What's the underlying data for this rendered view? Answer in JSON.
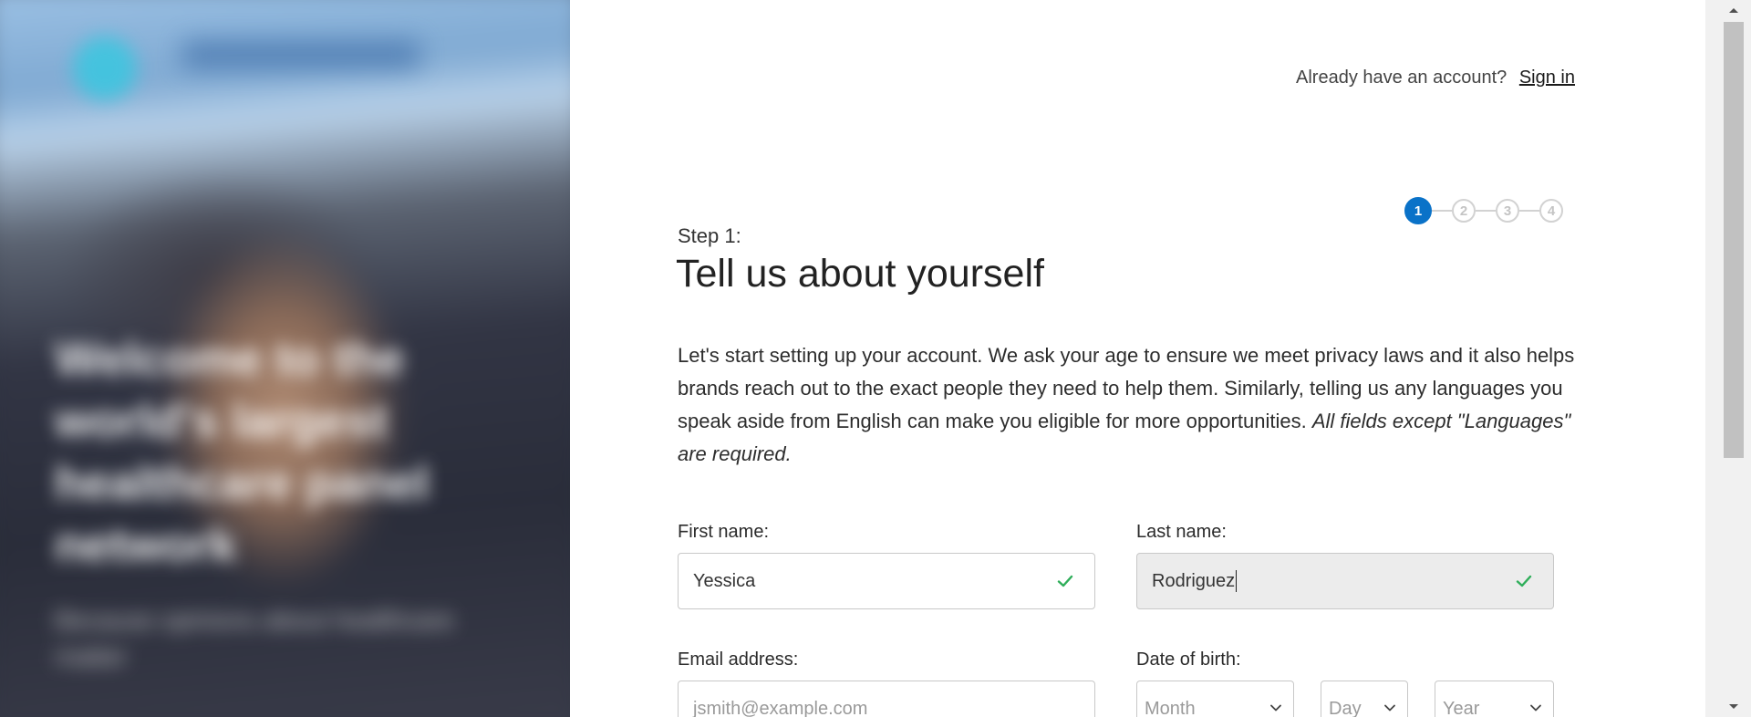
{
  "hero": {
    "headline": "Welcome to the world's largest healthcare panel network",
    "subtext": "Because opinions about healthcare matter"
  },
  "header": {
    "account_prompt": "Already have an account?",
    "signin_label": "Sign in"
  },
  "stepper": {
    "steps": [
      "1",
      "2",
      "3",
      "4"
    ],
    "current": 1
  },
  "main": {
    "step_label": "Step 1:",
    "title": "Tell us about yourself",
    "intro": "Let's start setting up your account. We ask your age to ensure we meet privacy laws and it also helps brands reach out to the exact people they need to help them. Similarly, telling us any languages you speak aside from English can make you eligible for more opportunities.",
    "intro_note": "All fields except \"Languages\" are required."
  },
  "form": {
    "first_name": {
      "label": "First name:",
      "value": "Yessica"
    },
    "last_name": {
      "label": "Last name:",
      "value": "Rodriguez"
    },
    "email": {
      "label": "Email address:",
      "placeholder": "jsmith@example.com"
    },
    "dob": {
      "label": "Date of birth:",
      "month_placeholder": "Month",
      "day_placeholder": "Day",
      "year_placeholder": "Year"
    }
  },
  "colors": {
    "accent": "#0a72c8",
    "valid_check": "#2fae5a",
    "step_inactive": "#d2d2d2"
  },
  "icons": {
    "valid": "check-icon",
    "dropdown": "chevron-down-icon"
  }
}
